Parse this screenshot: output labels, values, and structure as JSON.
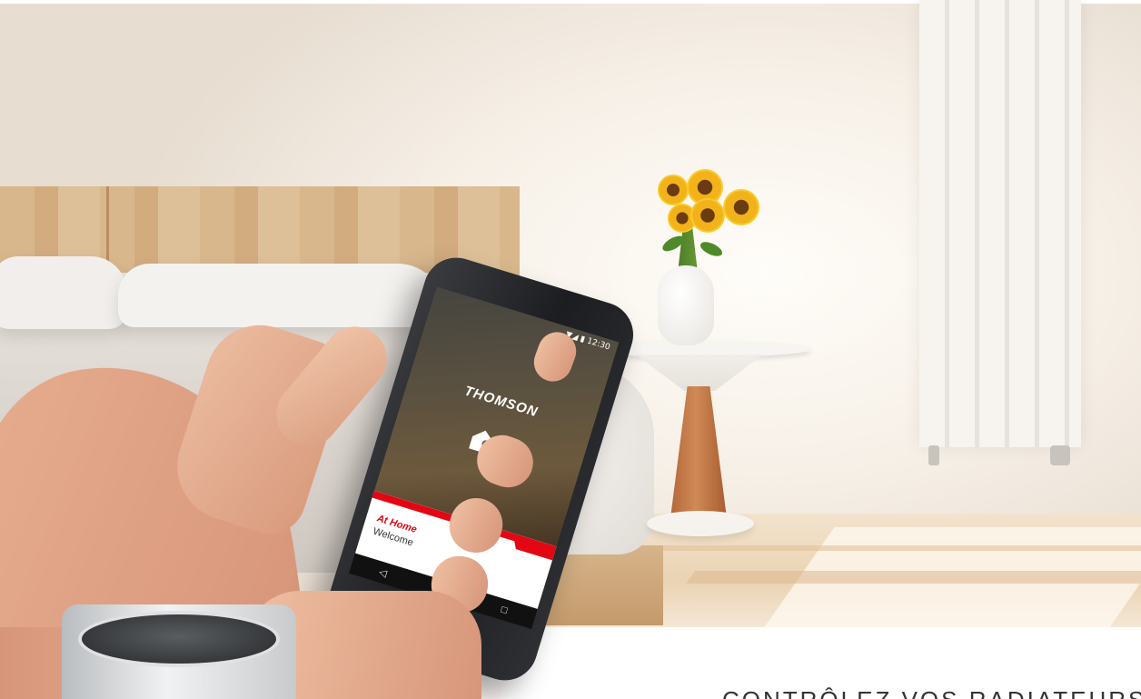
{
  "phone_app": {
    "status_time": "12:30",
    "brand_logo": "THOMSON",
    "home_icon": "house-wifi-icon",
    "banner_title": "At Home",
    "banner_subtitle": "Welcome",
    "nav": {
      "back": "◁",
      "home": "○",
      "recents": "□"
    }
  },
  "thermostat_display": "",
  "headline": "CONTRÔLEZ VOS RADIATEURS",
  "colors": {
    "accent_red": "#e30613",
    "wall": "#f6efe6"
  }
}
